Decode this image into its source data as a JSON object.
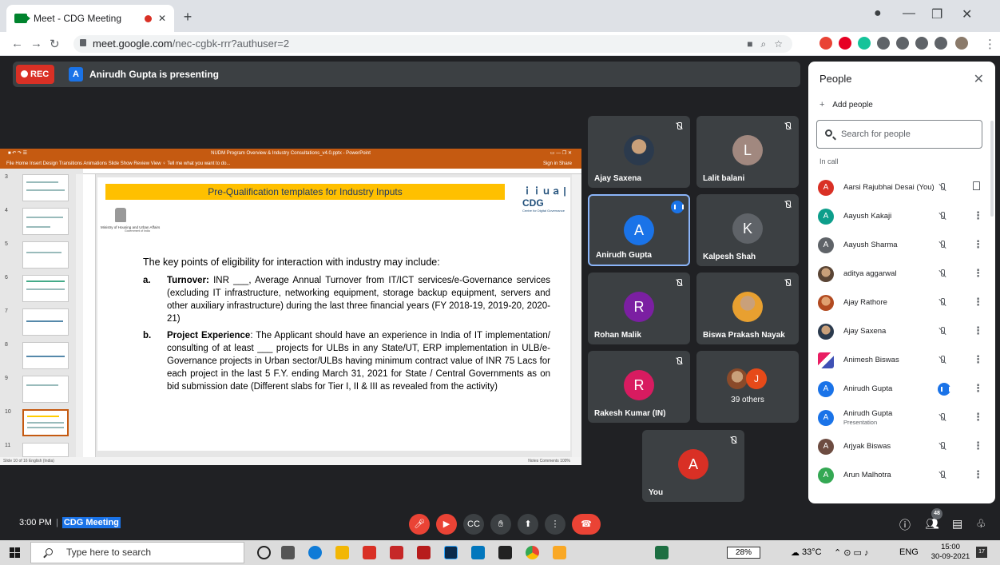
{
  "browser": {
    "tab_title": "Meet - CDG Meeting",
    "url_host": "meet.google.com",
    "url_path": "/nec-cgbk-rrr?authuser=2"
  },
  "meet": {
    "rec_label": "REC",
    "presenter_initial": "A",
    "presenting_text": "Anirudh Gupta is presenting",
    "time": "3:00 PM",
    "meeting_name": "CDG Meeting",
    "people_count": "48"
  },
  "ppt": {
    "window_title": "NUDM Program Overview & Industry Consultations_v4.0.pptx - PowerPoint",
    "ribbon": "File   Home   Insert   Design   Transitions   Animations   Slide Show   Review   View   ♀ Tell me what you want to do...",
    "ribbon_right": "Sign in  Share",
    "status_left": "Slide 10 of 16   English (India)",
    "status_right": "Notes   Comments   100%",
    "thumb_numbers": [
      "3",
      "4",
      "5",
      "6",
      "7",
      "8",
      "9",
      "10",
      "11"
    ]
  },
  "slide": {
    "banner": "Pre-Qualification templates for Industry Inputs",
    "logo_text": "ｉｉｕａ | CDG",
    "logo_sub": "Centre for Digital Governance",
    "ministry": "Ministry of Housing and Urban Affairs",
    "ministry_sub": "Government of India",
    "intro": "The key points of eligibility for interaction with industry may include:",
    "point_a_letter": "a.",
    "point_a_head": "Turnover:",
    "point_a_body": " INR ___, Average Annual Turnover from IT/ICT services/e-Governance services (excluding IT infrastructure, networking equipment, storage backup equipment, servers and other auxiliary infrastructure) during the last three financial years (FY 2018-19, 2019-20, 2020-21)",
    "point_b_letter": "b.",
    "point_b_head": "Project Experience",
    "point_b_body": ": The Applicant should have an experience in India of IT implementation/ consulting of at least ___ projects for ULBs in any State/UT, ERP implementation in ULB/e-Governance projects in Urban sector/ULBs having minimum contract value of INR 75 Lacs for each project in the last 5 F.Y. ending March 31, 2021 for State / Central Governments as on bid submission date (Different slabs for Tier I, II & III as revealed from the activity)"
  },
  "tiles": [
    {
      "name": "Ajay Saxena"
    },
    {
      "name": "Lalit balani",
      "initial": "L"
    },
    {
      "name": "Anirudh Gupta",
      "initial": "A"
    },
    {
      "name": "Kalpesh Shah",
      "initial": "K"
    },
    {
      "name": "Rohan Malik",
      "initial": "R"
    },
    {
      "name": "Biswa Prakash Nayak"
    },
    {
      "name": "Rakesh Kumar (IN)",
      "initial": "R"
    },
    {
      "name": "39 others",
      "initial": "J"
    },
    {
      "name": "You",
      "initial": "A"
    }
  ],
  "people_panel": {
    "title": "People",
    "add_people": "Add people",
    "search_placeholder": "Search for people",
    "section": "In call",
    "people": [
      {
        "initial": "A",
        "name": "Aarsi Rajubhai Desai (You)"
      },
      {
        "initial": "A",
        "name": "Aayush Kakaji"
      },
      {
        "initial": "A",
        "name": "Aayush Sharma"
      },
      {
        "initial": "",
        "name": "aditya aggarwal"
      },
      {
        "initial": "",
        "name": "Ajay Rathore"
      },
      {
        "initial": "",
        "name": "Ajay Saxena"
      },
      {
        "initial": "",
        "name": "Animesh Biswas"
      },
      {
        "initial": "A",
        "name": "Anirudh Gupta"
      },
      {
        "initial": "A",
        "name": "Anirudh Gupta",
        "sub": "Presentation"
      },
      {
        "initial": "A",
        "name": "Arjyak Biswas"
      },
      {
        "initial": "A",
        "name": "Arun Malhotra"
      }
    ]
  },
  "taskbar": {
    "search_placeholder": "Type here to search",
    "battery": "28%",
    "weather": "33°C",
    "lang": "ENG",
    "time": "15:00",
    "date": "30-09-2021",
    "notifications": "17"
  },
  "colors": {
    "meet_bg": "#202124",
    "tile_bg": "#3c4043",
    "accent_blue": "#1a73e8",
    "rec_red": "#d93025",
    "ppt_orange": "#c55a11",
    "banner_yellow": "#ffc000"
  }
}
